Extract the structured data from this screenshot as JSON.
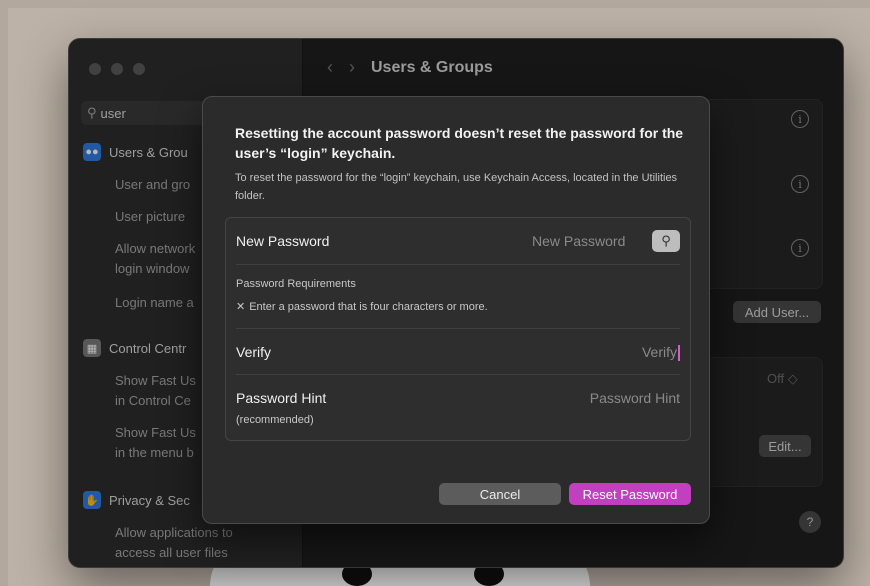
{
  "window": {
    "title": "Users & Groups"
  },
  "sidebar": {
    "search_value": "user",
    "groups": [
      {
        "label": "Users & Grou",
        "icon": "users-icon",
        "color": "#2f7de1",
        "items": [
          "User and gro",
          "User picture",
          "Allow network",
          "login window",
          "Login name a"
        ]
      },
      {
        "label": "Control Centr",
        "icon": "control-center-icon",
        "color": "#7a7a7a",
        "items": [
          "Show Fast Us",
          "in Control Ce",
          "Show Fast Us",
          "in the menu b"
        ]
      },
      {
        "label": "Privacy & Sec",
        "icon": "hand-icon",
        "color": "#2f7de1",
        "items": [
          "Allow applications to",
          "access all user files"
        ]
      }
    ]
  },
  "main": {
    "add_user_button": "Add User...",
    "off_label": "Off ◇",
    "edit_button": "Edit...",
    "help_button": "?"
  },
  "sheet": {
    "heading": "Resetting the account password doesn’t reset the password for the user’s “login” keychain.",
    "subtext": "To reset the password for the “login” keychain, use Keychain Access, located in the Utilities folder.",
    "new_password_label": "New Password",
    "new_password_placeholder": "New Password",
    "requirements_title": "Password Requirements",
    "requirement": "Enter a password that is four characters or more.",
    "verify_label": "Verify",
    "verify_placeholder": "Verify",
    "hint_label": "Password Hint",
    "hint_sublabel": "(recommended)",
    "hint_placeholder": "Password Hint",
    "cancel_button": "Cancel",
    "reset_button": "Reset Password",
    "accent_color": "#c23fc0"
  }
}
